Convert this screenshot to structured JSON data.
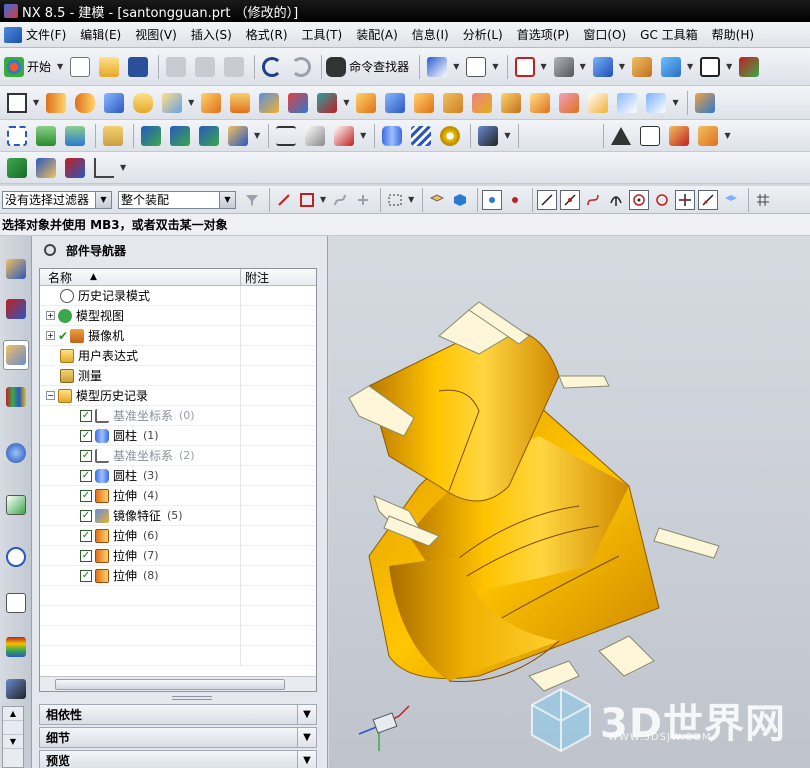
{
  "window": {
    "title": "NX 8.5 - 建模 - [santongguan.prt （修改的）]"
  },
  "menu": {
    "items": [
      "文件(F)",
      "编辑(E)",
      "视图(V)",
      "插入(S)",
      "格式(R)",
      "工具(T)",
      "装配(A)",
      "信息(I)",
      "分析(L)",
      "首选项(P)",
      "窗口(O)",
      "GC 工具箱",
      "帮助(H)"
    ]
  },
  "toolbar": {
    "start_label": "开始",
    "command_finder_label": "命令查找器"
  },
  "selection_bar": {
    "filter_value": "没有选择过滤器",
    "scope_value": "整个装配"
  },
  "status": {
    "prompt": "选择对象并使用 MB3，或者双击某一对象"
  },
  "navigator": {
    "title": "部件导航器",
    "col_name": "名称",
    "col_note": "附注",
    "rows": [
      {
        "label": "历史记录模式",
        "num": ""
      },
      {
        "label": "模型视图",
        "num": ""
      },
      {
        "label": "摄像机",
        "num": ""
      },
      {
        "label": "用户表达式",
        "num": ""
      },
      {
        "label": "测量",
        "num": ""
      },
      {
        "label": "模型历史记录",
        "num": ""
      },
      {
        "label": "基准坐标系",
        "num": "(0)"
      },
      {
        "label": "圆柱",
        "num": "(1)"
      },
      {
        "label": "基准坐标系",
        "num": "(2)"
      },
      {
        "label": "圆柱",
        "num": "(3)"
      },
      {
        "label": "拉伸",
        "num": "(4)"
      },
      {
        "label": "镜像特征",
        "num": "(5)"
      },
      {
        "label": "拉伸",
        "num": "(6)"
      },
      {
        "label": "拉伸",
        "num": "(7)"
      },
      {
        "label": "拉伸",
        "num": "(8)"
      }
    ],
    "panels": [
      "相依性",
      "细节",
      "预览"
    ]
  },
  "watermark": {
    "title": "3D世界网",
    "url": "WWW.3DSJW.COM"
  },
  "colors": {
    "part_gold": "#f2b400",
    "part_section": "#fdf6d8",
    "background": "#c9ced6"
  }
}
